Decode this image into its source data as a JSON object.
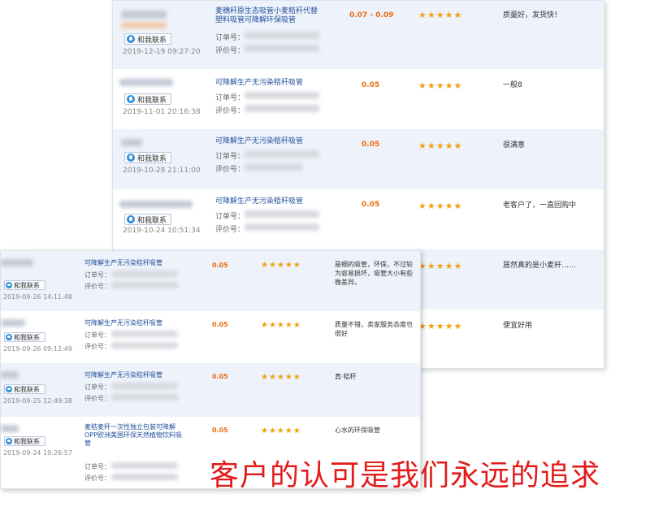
{
  "contact_label": "和我联系",
  "order_label": "订单号：",
  "review_label": "评价号：",
  "stars": "★★★★★",
  "colors": {
    "price": "#ee6a0e",
    "link": "#1f4e99",
    "stars": "#f2a00f",
    "slogan": "#e21b1b"
  },
  "back_reviews": [
    {
      "product": "麦穗秆原生态吸管小麦秸秆代替塑料吸管可降解环保吸管",
      "date": "2019-12-19 09:27:20",
      "price": "0.07 - 0.09",
      "comment": "质量好，发货快！"
    },
    {
      "product": "可降解生产无污染秸秆吸管",
      "date": "2019-11-01 20:16:38",
      "price": "0.05",
      "comment": "一般8"
    },
    {
      "product": "可降解生产无污染秸秆吸管",
      "date": "2019-10-28 21:11:00",
      "price": "0.05",
      "comment": "很满意"
    },
    {
      "product": "可降解生产无污染秸秆吸管",
      "date": "2019-10-24 10:51:34",
      "price": "0.05",
      "comment": "老客户了，一直回购中"
    },
    {
      "comment": "居然真的是小麦杆……"
    },
    {
      "comment": "便宜好用"
    }
  ],
  "front_reviews": [
    {
      "product": "可降解生产无污染秸秆吸管",
      "date": "2019-09-26 14:11:48",
      "price": "0.05",
      "comment": "是细的吸管，环保，不过较为容易损坏，吸管大小有些微差异。"
    },
    {
      "product": "可降解生产无污染秸秆吸管",
      "date": "2019-09-26 09:12:49",
      "price": "0.05",
      "comment": "质量不错，卖家服务态度也很好"
    },
    {
      "product": "可降解生产无污染秸秆吸管",
      "date": "2019-09-25 12:49:38",
      "price": "0.05",
      "comment": "真·秸秆"
    },
    {
      "product": "麦秸麦秆一次性独立包装可降解OPP欧洲美国环保天然植物饮料吸管",
      "date": "2019-09-24 19:26:57",
      "price": "0.05",
      "comment": "心水的环保吸管"
    }
  ],
  "slogan": "客户的认可是我们永远的追求"
}
